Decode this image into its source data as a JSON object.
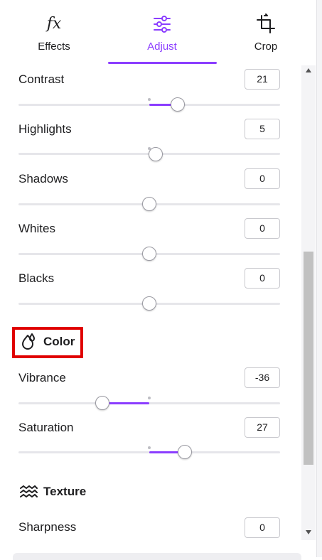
{
  "tabs": [
    {
      "label": "Effects",
      "icon": "fx-icon",
      "glyph": "fx"
    },
    {
      "label": "Adjust",
      "icon": "sliders-icon",
      "active": true
    },
    {
      "label": "Crop",
      "icon": "crop-icon"
    }
  ],
  "adjustments": [
    {
      "label": "Contrast",
      "value": "21",
      "level": 21
    },
    {
      "label": "Highlights",
      "value": "5",
      "level": 5
    },
    {
      "label": "Shadows",
      "value": "0",
      "level": 0
    },
    {
      "label": "Whites",
      "value": "0",
      "level": 0
    },
    {
      "label": "Blacks",
      "value": "0",
      "level": 0
    }
  ],
  "color_section": {
    "title": "Color",
    "icon": "droplets-icon",
    "items": [
      {
        "label": "Vibrance",
        "value": "-36",
        "level": -36
      },
      {
        "label": "Saturation",
        "value": "27",
        "level": 27
      }
    ]
  },
  "texture_section": {
    "title": "Texture",
    "icon": "waves-icon",
    "items": [
      {
        "label": "Sharpness",
        "value": "0",
        "level": 0
      }
    ]
  },
  "colors": {
    "accent": "#8b3dff",
    "highlight_border": "#e00000"
  }
}
